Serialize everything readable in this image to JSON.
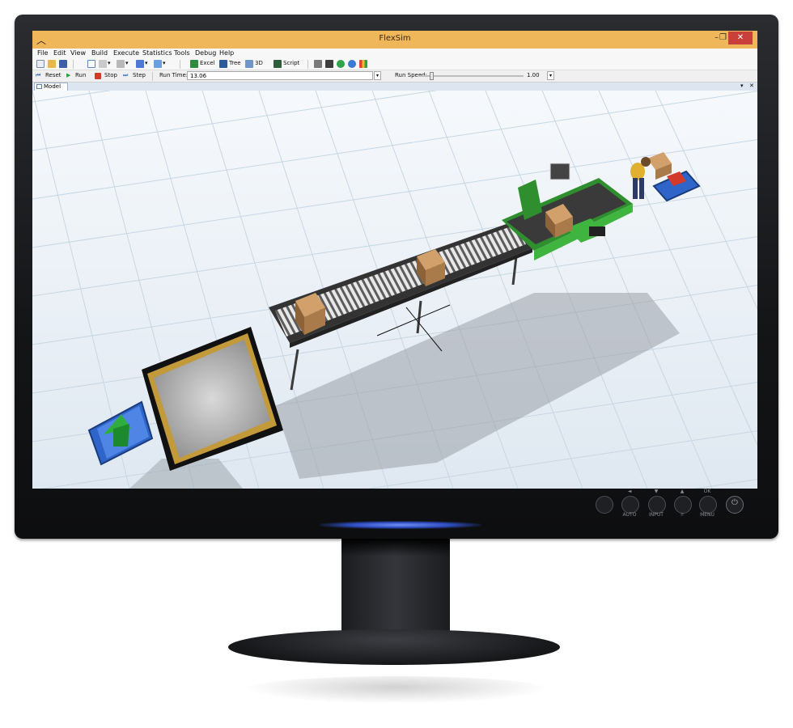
{
  "window": {
    "title": "FlexSim",
    "minimize": "–",
    "restore": "❐",
    "close": "✕"
  },
  "menu": [
    "File",
    "Edit",
    "View",
    "Build",
    "Execute",
    "Statistics",
    "Tools",
    "Debug",
    "Help"
  ],
  "toolbar": {
    "excel": "Excel",
    "tree": "Tree",
    "three_d": "3D",
    "script": "Script"
  },
  "run_controls": {
    "reset": "Reset",
    "run": "Run",
    "stop": "Stop",
    "step": "Step",
    "run_time_label": "Run Time:",
    "run_time_value": "13.06",
    "run_speed_label": "Run Speed:",
    "run_speed_value": "1.00"
  },
  "tab": {
    "model_label": "Model",
    "pin": "▾",
    "close": "✕"
  },
  "monitor": {
    "buttons": [
      "AUTO",
      "INPUT",
      "MENU"
    ],
    "ok_label": "OK",
    "brightness_label": "☼",
    "power": "⏻"
  },
  "colors": {
    "titlebar": "#f0b75a",
    "close": "#c9403a",
    "conveyor_green": "#3fb43f",
    "box": "#b98a5a",
    "floor_grid": "#c8d6e2"
  }
}
